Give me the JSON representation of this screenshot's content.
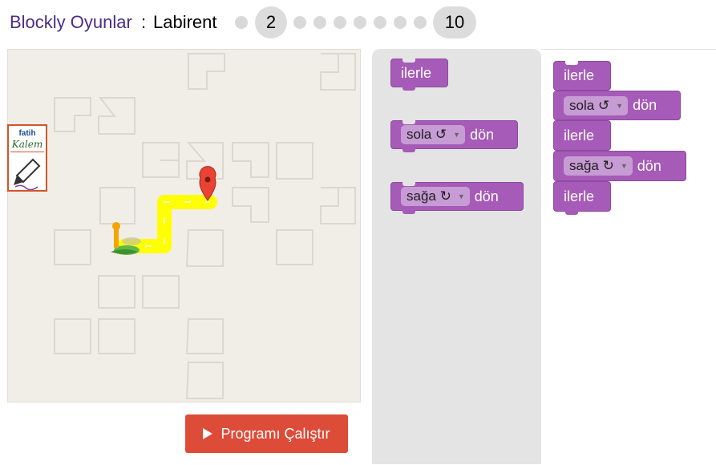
{
  "header": {
    "app_title": "Blockly Oyunlar",
    "separator": ":",
    "page_title": "Labirent",
    "levels": {
      "current_label": "2",
      "last_label": "10",
      "total": 10
    }
  },
  "run_button": {
    "label": "Programı Çalıştır"
  },
  "logo": {
    "line1": "fatih",
    "line2": "Kalem"
  },
  "toolbox": {
    "blocks": [
      {
        "label": "ilerle"
      },
      {
        "dropdown": "sola ↺",
        "suffix": "dön"
      },
      {
        "dropdown": "sağa ↻",
        "suffix": "dön"
      }
    ]
  },
  "workspace": {
    "program": [
      {
        "label": "ilerle"
      },
      {
        "dropdown": "sola ↺",
        "suffix": "dön"
      },
      {
        "label": "ilerle"
      },
      {
        "dropdown": "sağa ↻",
        "suffix": "dön"
      },
      {
        "label": "ilerle"
      }
    ]
  },
  "colors": {
    "block": "#a55bb7",
    "run_button": "#dd4b39",
    "title_link": "#4b2c86",
    "path": "#ffff00"
  }
}
